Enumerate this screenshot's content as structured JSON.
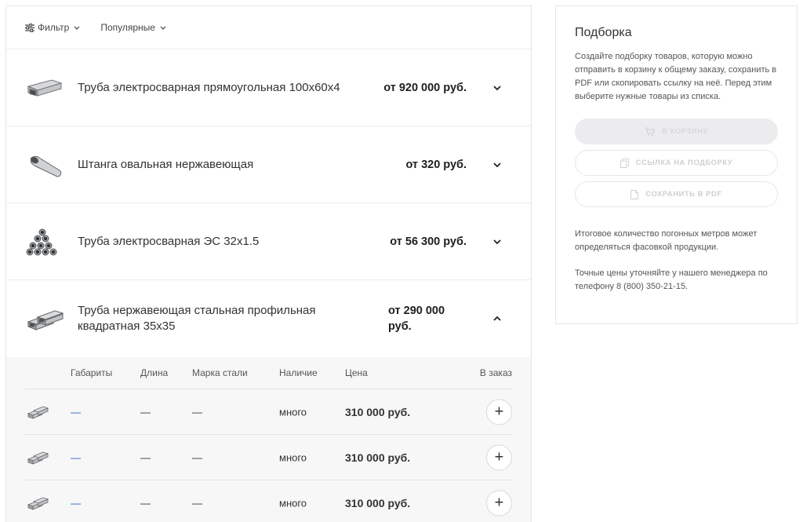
{
  "filter": {
    "filter_label": "Фильтр",
    "sort_label": "Популярные"
  },
  "products": [
    {
      "name": "Труба электросварная прямоугольная 100х60х4",
      "price": "от 920 000 руб.",
      "image": "rectangular-pipe-icon"
    },
    {
      "name": "Штанга овальная нержавеющая",
      "price": "от 320 руб.",
      "image": "oval-bar-icon"
    },
    {
      "name": "Труба электросварная ЭС 32х1.5",
      "price": "от 56 300 руб.",
      "image": "round-pipes-bundle-icon"
    },
    {
      "name": "Труба нержавеющая стальная профильная квадратная 35х35",
      "price": "от 290 000 руб.",
      "image": "square-pipes-icon"
    }
  ],
  "variants": {
    "headers": {
      "size": "Габариты",
      "length": "Длина",
      "steel": "Марка стали",
      "stock": "Наличие",
      "price": "Цена",
      "order": "В заказ"
    },
    "rows": [
      {
        "size": "—",
        "length": "—",
        "steel": "—",
        "stock": "много",
        "price": "310 000 руб.",
        "add": "+"
      },
      {
        "size": "—",
        "length": "—",
        "steel": "—",
        "stock": "много",
        "price": "310 000 руб.",
        "add": "+"
      },
      {
        "size": "—",
        "length": "—",
        "steel": "—",
        "stock": "много",
        "price": "310 000 руб.",
        "add": "+"
      }
    ]
  },
  "sidebar": {
    "title": "Подборка",
    "description": "Создайте подборку товаров, которую можно отправить в корзину к общему заказу, сохранить в PDF или скопировать ссылку на неё. Перед этим выберите нужные товары из списка.",
    "btn_cart": "В корзину",
    "btn_link": "Ссылка на подборку",
    "btn_pdf": "Сохранить в PDF",
    "note1": "Итоговое количество погонных метров может определяться фасовкой продукции.",
    "note2": "Точные цены уточняйте у нашего менеджера по телефону 8 (800) 350-21-15."
  },
  "colors": {
    "link": "#2c5cc5",
    "border": "#e6e6e6",
    "disabled_text": "#cfcfd4"
  }
}
